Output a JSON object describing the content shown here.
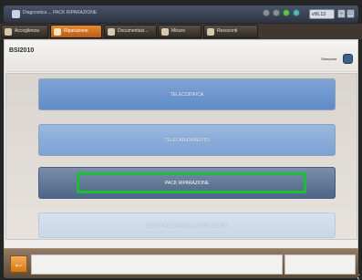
{
  "window": {
    "title": "Diagnostica ... PACK RIPARAZIONE",
    "version": "v06.13",
    "status_icons": [
      "status-dot",
      "status-dot",
      "green-status-icon",
      "teal-status-icon"
    ],
    "controls": [
      "minimize",
      "maximize",
      "close"
    ]
  },
  "tabs": [
    {
      "label": "Accoglienza",
      "icon": "home-icon",
      "active": false
    },
    {
      "label": "Riparazione",
      "icon": "wrench-icon",
      "active": true
    },
    {
      "label": "Documentazi...",
      "icon": "document-icon",
      "active": false
    },
    {
      "label": "Misure",
      "icon": "meter-icon",
      "active": false
    },
    {
      "label": "Resoconti",
      "icon": "report-icon",
      "active": false
    }
  ],
  "page": {
    "title": "BSI2010",
    "print_label": "Stampare"
  },
  "menu": [
    {
      "label": "TELECODIFICA"
    },
    {
      "label": "TELECARICAMENTO"
    },
    {
      "label": "PACK RIPARAZIONE",
      "selected": true
    },
    {
      "label": "LETTURA E CANCELLAZIONE GUASTI"
    }
  ],
  "footer": {
    "back_symbol": "←",
    "message": ""
  },
  "colors": {
    "active_tab": "#e07d28",
    "selection_border": "#1ebd37",
    "panel_bg": "#efeeec"
  }
}
